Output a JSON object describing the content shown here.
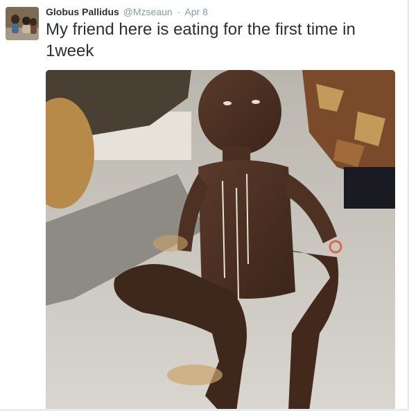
{
  "tweet": {
    "author": {
      "fullname": "Globus Pallidus",
      "username": "@Mzseaun",
      "avatar_icon": "profile-photo"
    },
    "separator": "·",
    "timestamp": "Apr 8",
    "text": "My friend here is eating for the first time in 1week",
    "media": {
      "kind": "photo"
    }
  },
  "colors": {
    "name": "#292f33",
    "meta": "#8899a6",
    "text": "#292f33",
    "background": "#ffffff"
  }
}
